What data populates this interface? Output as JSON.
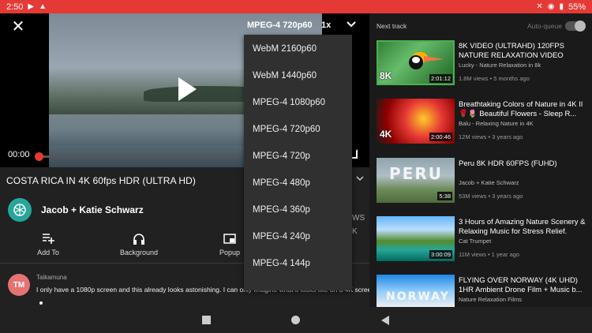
{
  "status_bar": {
    "time": "2:50",
    "battery": "55%"
  },
  "player": {
    "current_time": "00:00",
    "quality_label": "MPEG-4 720p60",
    "speed_label": "1x"
  },
  "video": {
    "title": "COSTA RICA IN 4K 60fps HDR (ULTRA HD)",
    "channel": "Jacob + Katie Schwarz",
    "side_text_1": "WS",
    "side_text_2": "K"
  },
  "actions": [
    {
      "label": "Add To"
    },
    {
      "label": "Background"
    },
    {
      "label": "Popup"
    }
  ],
  "comment": {
    "avatar_text": "TM",
    "author": "Taikamuna",
    "text": "I only have a 1080p screen and this already looks astonishing. I can only imagine what it looks like on a 4K screen"
  },
  "quality_menu": {
    "items": [
      "WebM 2160p60",
      "WebM 1440p60",
      "MPEG-4 1080p60",
      "MPEG-4 720p60",
      "MPEG-4 720p",
      "MPEG-4 480p",
      "MPEG-4 360p",
      "MPEG-4 240p",
      "MPEG-4 144p"
    ]
  },
  "queue": {
    "next_label": "Next track",
    "autoqueue_label": "Auto-queue",
    "tracks": [
      {
        "title": "8K VIDEO (ULTRAHD) 120FPS NATURE RELAXATION VIDEO WILD...",
        "channel": "Lucky - Nature Relaxation in 8k",
        "meta": "1.8M views • 5 months ago",
        "duration": "2:01:12",
        "overlay": "8K"
      },
      {
        "title": "Breathtaking Colors of Nature in 4K II 🌹🌷 Beautiful Flowers - Sleep R...",
        "channel": "Balu - Relaxing Nature in 4K",
        "meta": "12M views • 3 years ago",
        "duration": "2:00:46",
        "overlay": "4K"
      },
      {
        "title": "Peru 8K HDR 60FPS (FUHD)",
        "channel": "Jacob + Katie Schwarz",
        "meta": "53M views • 3 years ago",
        "duration": "5:38",
        "overlay": "PERU"
      },
      {
        "title": "3 Hours of Amazing Nature Scenery & Relaxing Music for Stress Relief.",
        "channel": "Cat Trumpet",
        "meta": "11M views • 1 year ago",
        "duration": "3:00:09",
        "overlay": ""
      },
      {
        "title": "FLYING OVER NORWAY (4K UHD) 1HR Ambient Drone Film + Music b...",
        "channel": "Nature Relaxation Films",
        "meta": "",
        "duration": "",
        "overlay": "NORWAY"
      }
    ]
  }
}
